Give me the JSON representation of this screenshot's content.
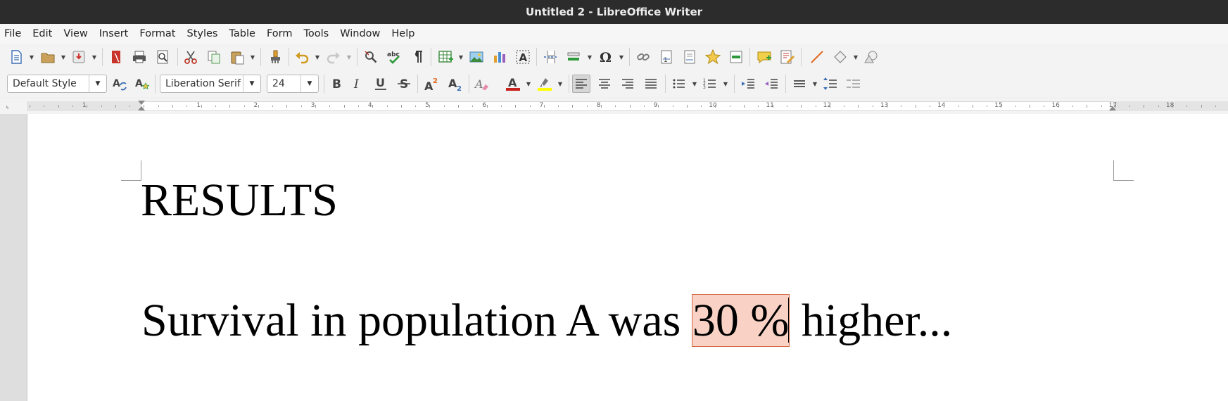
{
  "window": {
    "title": "Untitled 2 - LibreOffice Writer"
  },
  "menu": [
    "File",
    "Edit",
    "View",
    "Insert",
    "Format",
    "Styles",
    "Table",
    "Form",
    "Tools",
    "Window",
    "Help"
  ],
  "formatting": {
    "paragraph_style": "Default Style",
    "font_name": "Liberation Serif",
    "font_size": "24"
  },
  "ruler": {
    "labels": [
      "1",
      "1",
      "2",
      "3",
      "4",
      "5",
      "6",
      "7",
      "8",
      "9",
      "10",
      "11",
      "12",
      "13",
      "14",
      "15",
      "16",
      "17",
      "18"
    ]
  },
  "document": {
    "heading": "RESULTS",
    "line_before": "Survival in population A was ",
    "line_selected": "30 %",
    "line_after": " higher..."
  },
  "colors": {
    "titlebar": "#2c2c2c",
    "selection_fill": "#f9d2c5",
    "selection_border": "#d2673f",
    "font_color_bar": "#c9211e",
    "highlight_bar": "#ffff00"
  }
}
